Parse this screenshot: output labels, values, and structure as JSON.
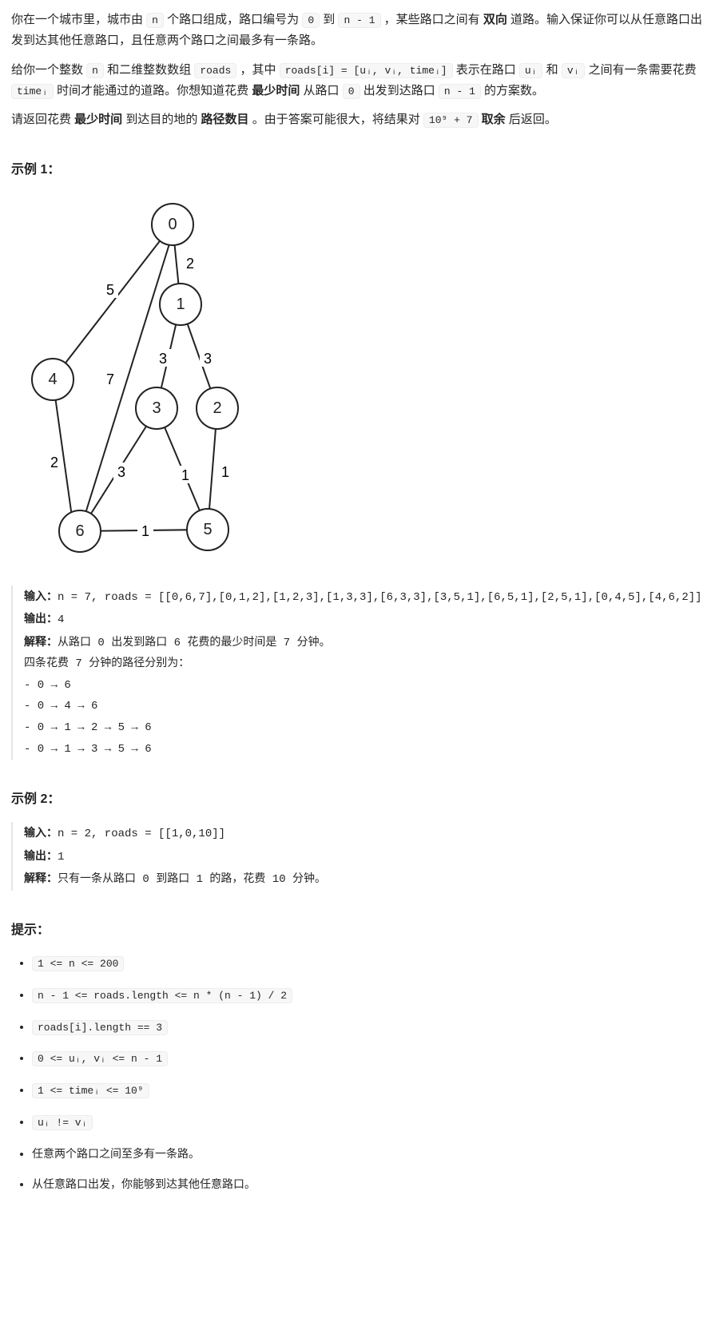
{
  "desc": {
    "p1a": "你在一个城市里，城市由 ",
    "p1_code1": "n",
    "p1b": " 个路口组成，路口编号为 ",
    "p1_code2": "0",
    "p1c": " 到 ",
    "p1_code3": "n - 1",
    "p1d": " ，某些路口之间有 ",
    "p1_bold1": "双向",
    "p1e": " 道路。输入保证你可以从任意路口出发到达其他任意路口，且任意两个路口之间最多有一条路。",
    "p2a": "给你一个整数 ",
    "p2_code1": "n",
    "p2b": " 和二维整数数组 ",
    "p2_code2": "roads",
    "p2c": " ，其中 ",
    "p2_code3": "roads[i] = [uᵢ, vᵢ, timeᵢ]",
    "p2d": " 表示在路口 ",
    "p2_code4": "uᵢ",
    "p2e": " 和 ",
    "p2_code5": "vᵢ",
    "p2f": " 之间有一条需要花费 ",
    "p2_code6": "timeᵢ",
    "p2g": " 时间才能通过的道路。你想知道花费 ",
    "p2_bold1": "最少时间",
    "p2h": " 从路口 ",
    "p2_code7": "0",
    "p2i": " 出发到达路口 ",
    "p2_code8": "n - 1",
    "p2j": " 的方案数。",
    "p3a": "请返回花费 ",
    "p3_bold1": "最少时间",
    "p3b": " 到达目的地的 ",
    "p3_bold2": "路径数目",
    "p3c": " 。由于答案可能很大，将结果对 ",
    "p3_code1": "10⁹ + 7",
    "p3d": " ",
    "p3_bold3": "取余",
    "p3e": " 后返回。"
  },
  "example1": {
    "title": "示例 1：",
    "input_label": "输入：",
    "input": "n = 7, roads = [[0,6,7],[0,1,2],[1,2,3],[1,3,3],[6,3,3],[3,5,1],[6,5,1],[2,5,1],[0,4,5],[4,6,2]]",
    "output_label": "输出：",
    "output": "4",
    "explain_label": "解释：",
    "explain_line1": "从路口 0 出发到路口 6 花费的最少时间是 7 分钟。",
    "explain_line2": "四条花费 7 分钟的路径分别为：",
    "path1": "- 0 → 6",
    "path2": "- 0 → 4 → 6",
    "path3": "- 0 → 1 → 2 → 5 → 6",
    "path4": "- 0 → 1 → 3 → 5 → 6"
  },
  "example2": {
    "title": "示例 2：",
    "input_label": "输入：",
    "input": "n = 2, roads = [[1,0,10]]",
    "output_label": "输出：",
    "output": "1",
    "explain_label": "解释：",
    "explain": "只有一条从路口 0 到路口 1 的路，花费 10 分钟。"
  },
  "hints": {
    "title": "提示：",
    "c1": "1 <= n <= 200",
    "c2": "n - 1 <= roads.length <= n * (n - 1) / 2",
    "c3": "roads[i].length == 3",
    "c4": "0 <= uᵢ, vᵢ <= n - 1",
    "c5": "1 <= timeᵢ <= 10⁹",
    "c6": "uᵢ != vᵢ",
    "c7": "任意两个路口之间至多有一条路。",
    "c8": "从任意路口出发，你能够到达其他任意路口。"
  },
  "graph": {
    "nodes": {
      "n0": "0",
      "n1": "1",
      "n2": "2",
      "n3": "3",
      "n4": "4",
      "n5": "5",
      "n6": "6"
    },
    "edges": {
      "e04": "5",
      "e01": "2",
      "e06": "7",
      "e13": "3",
      "e12": "3",
      "e25": "1",
      "e35": "1",
      "e63": "3",
      "e65": "1",
      "e46": "2"
    }
  }
}
